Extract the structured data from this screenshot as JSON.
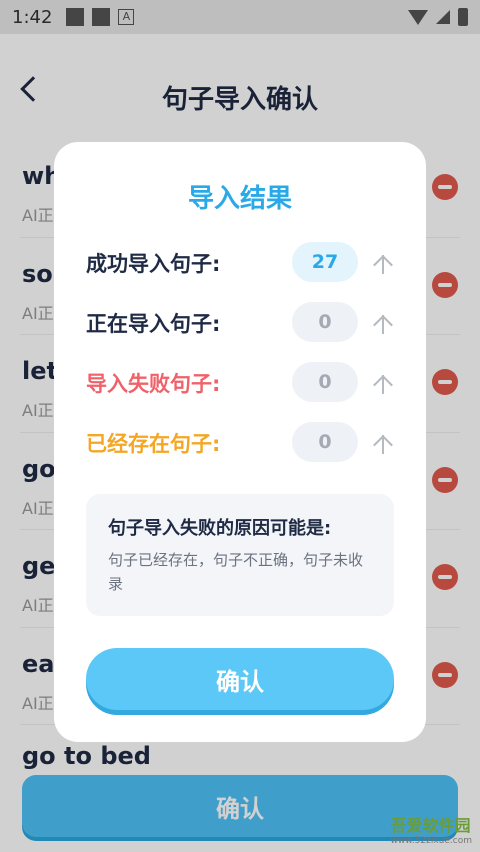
{
  "status_bar": {
    "time": "1:42"
  },
  "header": {
    "title": "句子导入确认"
  },
  "list": {
    "items": [
      {
        "en": "wh",
        "sub": "AI正"
      },
      {
        "en": "sou",
        "sub": "AI正"
      },
      {
        "en": "let",
        "sub": "AI正"
      },
      {
        "en": "go",
        "sub": "AI正"
      },
      {
        "en": "get",
        "sub": "AI正"
      },
      {
        "en": "eat",
        "sub": "AI正"
      }
    ],
    "last_item": "go to bed"
  },
  "bottom": {
    "confirm_label": "确认"
  },
  "watermark": {
    "text": "吾爱软件园",
    "url": "www.52zixue.com"
  },
  "dialog": {
    "title": "导入结果",
    "rows": [
      {
        "label": "成功导入句子:",
        "count": "27",
        "color": "#1f2a44"
      },
      {
        "label": "正在导入句子:",
        "count": "0",
        "color": "#1f2a44"
      },
      {
        "label": "导入失败句子:",
        "count": "0",
        "color": "#f0616a"
      },
      {
        "label": "已经存在句子:",
        "count": "0",
        "color": "#f5a623"
      }
    ],
    "reason_title": "句子导入失败的原因可能是:",
    "reason_text": "句子已经存在，句子不正确，句子未收录",
    "confirm_label": "确认"
  }
}
